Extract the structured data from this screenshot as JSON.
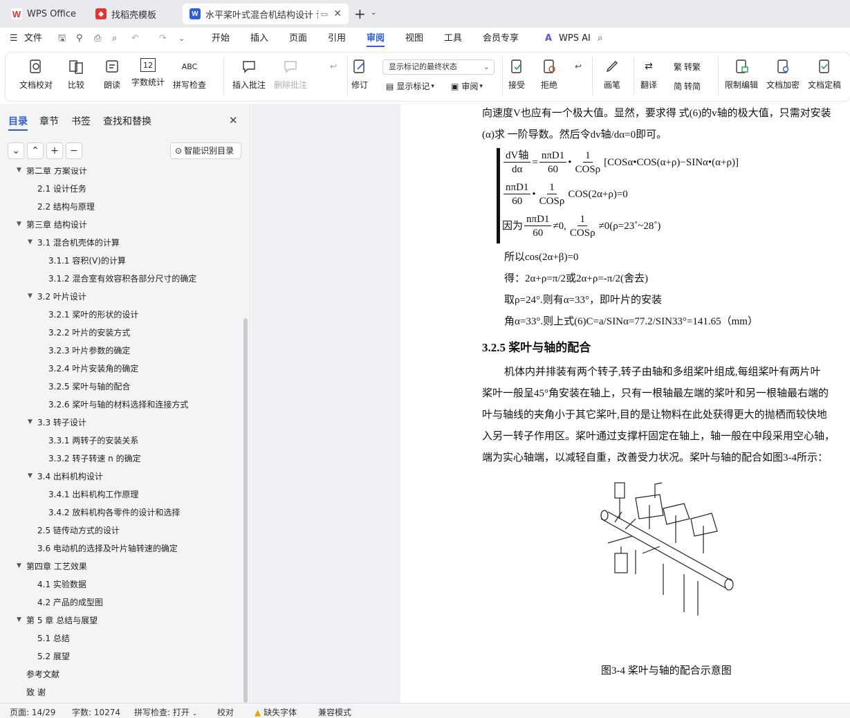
{
  "tabs": [
    {
      "label": "WPS Office",
      "icon": "wps-logo-icon"
    },
    {
      "label": "找稻壳模板",
      "icon": "docer-icon"
    },
    {
      "label": "水平桨叶式混合机结构设计 说",
      "icon": "word-doc-icon",
      "active": true
    }
  ],
  "menu": {
    "file": "文件",
    "items": [
      "开始",
      "插入",
      "页面",
      "引用",
      "审阅",
      "视图",
      "工具",
      "会员专享"
    ],
    "active": "审阅",
    "ai": "WPS AI"
  },
  "ribbon": {
    "buttons": [
      "文档校对",
      "比较",
      "朗读",
      "字数统计",
      "拼写检查",
      "插入批注",
      "删除批注",
      "修订",
      "显示标记",
      "审阅",
      "接受",
      "拒绝",
      "画笔",
      "翻译",
      "转繁",
      "转简",
      "限制编辑",
      "文档加密",
      "文档定稿"
    ],
    "markup_select": "显示标记的最终状态"
  },
  "sidebar": {
    "tabs": [
      "目录",
      "章节",
      "书签",
      "查找和替换"
    ],
    "smart_button": "智能识别目录",
    "toc": [
      {
        "level": 1,
        "text": "第二章  方案设计",
        "arrow": true
      },
      {
        "level": 2,
        "text": "2.1 设计任务"
      },
      {
        "level": 2,
        "text": "2.2 结构与原理"
      },
      {
        "level": 1,
        "text": "第三章  结构设计",
        "arrow": true
      },
      {
        "level": 2,
        "text": "3.1 混合机壳体的计算",
        "arrow": true
      },
      {
        "level": 3,
        "text": "3.1.1  容积(V)的计算"
      },
      {
        "level": 3,
        "text": "3.1.2  混合室有效容积各部分尺寸的确定"
      },
      {
        "level": 2,
        "text": "3.2 叶片设计",
        "arrow": true
      },
      {
        "level": 3,
        "text": "3.2.1 桨叶的形状的设计"
      },
      {
        "level": 3,
        "text": "3.2.2  叶片的安装方式"
      },
      {
        "level": 3,
        "text": "3.2.3  叶片参数的确定"
      },
      {
        "level": 3,
        "text": "3.2.4  叶片安装角的确定"
      },
      {
        "level": 3,
        "text": "3.2.5  桨叶与轴的配合"
      },
      {
        "level": 3,
        "text": "3.2.6 桨叶与轴的材料选择和连接方式"
      },
      {
        "level": 2,
        "text": "3.3  转子设计",
        "arrow": true
      },
      {
        "level": 3,
        "text": "3.3.1  两转子的安装关系"
      },
      {
        "level": 3,
        "text": "3.3.2  转子转速 n 的确定"
      },
      {
        "level": 2,
        "text": "3.4  出料机构设计",
        "arrow": true
      },
      {
        "level": 3,
        "text": "3.4.1 出料机构工作原理"
      },
      {
        "level": 3,
        "text": "3.4.2  放料机构各零件的设计和选择"
      },
      {
        "level": 2,
        "text": "2.5 链传动方式的设计"
      },
      {
        "level": 2,
        "text": "3.6 电动机的选择及叶片轴转速的确定"
      },
      {
        "level": 1,
        "text": "第四章  工艺效果",
        "arrow": true
      },
      {
        "level": 2,
        "text": "4.1 实验数据"
      },
      {
        "level": 2,
        "text": "4.2 产品的成型图"
      },
      {
        "level": 1,
        "text": "第 5 章  总结与展望",
        "arrow": true
      },
      {
        "level": 2,
        "text": "5.1  总结"
      },
      {
        "level": 2,
        "text": "5.2  展望"
      },
      {
        "level": 1,
        "text": "参考文献"
      },
      {
        "level": 1,
        "text": "致   谢"
      }
    ]
  },
  "doc": {
    "line1": "向速度V也应有一个极大值。显然，要求得  式(6)的v轴的极大值，只需对安装",
    "line2": "(α)求  一阶导数。然后令dv轴/dα=0即可。",
    "eq1_lhs_num": "dV轴",
    "eq1_lhs_den": "dα",
    "eq1_f1_num": "nπD1",
    "eq1_f1_den": "60",
    "eq1_f2_num": "1",
    "eq1_f2_den": "COSρ",
    "eq1_rest": "[COSα•COS(α+ρ)−SINα•(α+ρ)]",
    "eq2_f1_num": "nπD1",
    "eq2_f1_den": "60",
    "eq2_f2_num": "1",
    "eq2_f2_den": "COSρ",
    "eq2_rest": "COS(2α+ρ)=0",
    "eq3_prefix": "因为",
    "eq3_f1_num": "nπD1",
    "eq3_f1_den": "60",
    "eq3_mid": "≠0,",
    "eq3_f2_num": "1",
    "eq3_f2_den": "COSρ",
    "eq3_rest": "≠0(ρ=23˚~28˚)",
    "p1": "所以cos(2α+β)=0",
    "p2": "得：2α+ρ=π/2或2α+ρ=-π/2(舍去)",
    "p3": "取ρ=24°.则有α=33°，即叶片的安装",
    "p4": "角α=33°.则上式(6)C=a/SINα=77.2/SIN33°=141.65（mm）",
    "heading": "3.2.5  桨叶与轴的配合",
    "para": [
      "机体内并排装有两个转子,转子由轴和多组桨叶组成,每组桨叶有两片叶",
      "桨叶一般呈45°角安装在轴上，只有一根轴最左端的桨叶和另一根轴最右端的",
      "叶与轴线的夹角小于其它桨叶,目的是让物料在此处获得更大的抛栖而较快地",
      "入另一转子作用区。桨叶通过支撑杆固定在轴上，轴一般在中段采用空心轴，",
      "端为实心轴端，以减轻自重，改善受力状况。桨叶与轴的配合如图3-4所示："
    ],
    "caption": "图3-4  桨叶与轴的配合示意图"
  },
  "status": {
    "page": "页面: 14/29",
    "words": "字数: 10274",
    "spell": "拼写检查: 打开",
    "proof": "校对",
    "missing_font": "缺失字体",
    "compat": "兼容模式"
  }
}
